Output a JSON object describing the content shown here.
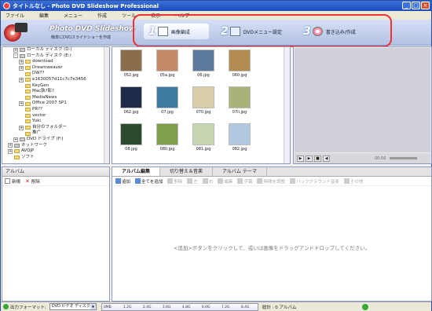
{
  "window": {
    "title": "タイトルなし - Photo DVD Slideshow Professional"
  },
  "menu": [
    "ファイル",
    "編集",
    "メニュー",
    "作成",
    "ツール",
    "表示",
    "ヘルプ"
  ],
  "banner": {
    "app_name": "Photo DVD Slideshow",
    "tagline": "簡単にDVDスライドショーを作成"
  },
  "steps": [
    {
      "num": "1",
      "label": "画像編成"
    },
    {
      "num": "2",
      "label": "DVDメニュー設定"
    },
    {
      "num": "3",
      "label": "書き込み/作成"
    }
  ],
  "tree": [
    {
      "label": "ローカル ディスク (D:)",
      "indent": 2,
      "exp": "+",
      "drive": true
    },
    {
      "label": "ローカル ディスク (E:)",
      "indent": 2,
      "exp": "-",
      "drive": true
    },
    {
      "label": "download",
      "indent": 3,
      "exp": "+"
    },
    {
      "label": "Dreamweaver",
      "indent": 3,
      "exp": "+"
    },
    {
      "label": "DW??",
      "indent": 3,
      "exp": ""
    },
    {
      "label": "e1630057d11c7c7e3456",
      "indent": 3,
      "exp": "+"
    },
    {
      "label": "KeyGen",
      "indent": 3,
      "exp": ""
    },
    {
      "label": "Mac執?影?",
      "indent": 3,
      "exp": ""
    },
    {
      "label": "MediaNews",
      "indent": 3,
      "exp": ""
    },
    {
      "label": "Office 2007 SP1",
      "indent": 3,
      "exp": "+"
    },
    {
      "label": "PR??",
      "indent": 3,
      "exp": ""
    },
    {
      "label": "vector",
      "indent": 3,
      "exp": ""
    },
    {
      "label": "Yuki",
      "indent": 3,
      "exp": ""
    },
    {
      "label": "自分のフォルダー",
      "indent": 3,
      "exp": "+"
    },
    {
      "label": "推广",
      "indent": 3,
      "exp": ""
    },
    {
      "label": "DVD ドライブ (F:)",
      "indent": 2,
      "exp": "+",
      "drive": true
    },
    {
      "label": "ネットワーク",
      "indent": 1,
      "exp": "+",
      "drive": true
    },
    {
      "label": "AVOJP",
      "indent": 1,
      "exp": "+"
    },
    {
      "label": "ソフト",
      "indent": 1,
      "exp": ""
    }
  ],
  "thumbnails": [
    {
      "caption": "052.jpg",
      "color": "#8a6d4a"
    },
    {
      "caption": "05a.jpg",
      "color": "#c48a6a"
    },
    {
      "caption": "06.jpg",
      "color": "#5d7a9c"
    },
    {
      "caption": "060.jpg",
      "color": "#b28b4f"
    },
    {
      "caption": "062.jpg",
      "color": "#1e2a48"
    },
    {
      "caption": "07.jpg",
      "color": "#3d7aa0"
    },
    {
      "caption": "070.jpg",
      "color": "#d8cfa8"
    },
    {
      "caption": "07ii.jpg",
      "color": "#a8b37a"
    },
    {
      "caption": "08.jpg",
      "color": "#2c4a2e"
    },
    {
      "caption": "080.jpg",
      "color": "#7fa04a"
    },
    {
      "caption": "081.jpg",
      "color": "#c6d6b0"
    },
    {
      "caption": "082.jpg",
      "color": "#b0c8e0"
    }
  ],
  "preview": {
    "time": "00:00"
  },
  "album_panel": {
    "tab": "アルバム",
    "new": "新規",
    "delete": "削除"
  },
  "main_tabs": [
    "アルバム編集",
    "切り替え＆音楽",
    "アルバム テーマ"
  ],
  "main_tools": [
    {
      "label": "追加",
      "enabled": true
    },
    {
      "label": "全てを追加",
      "enabled": true
    },
    {
      "label": "削除",
      "enabled": false
    },
    {
      "label": "左",
      "enabled": false
    },
    {
      "label": "右",
      "enabled": false
    },
    {
      "label": "編集",
      "enabled": false
    },
    {
      "label": "字幕",
      "enabled": false
    },
    {
      "label": "時間を調整",
      "enabled": false
    },
    {
      "label": "バックグラウンド音楽",
      "enabled": false
    },
    {
      "label": "その他",
      "enabled": false
    }
  ],
  "hint": "<追加>ボタンをクリックして、或いは画像をドラッグアンドドロップしてください。",
  "status": {
    "format_label": "出力フォーマット:",
    "format_value": "DVD ビデオ ディスク",
    "scale": [
      "0MB",
      "1.2G",
      "2.4G",
      "3.6G",
      "4.8G",
      "6.0G",
      "7.2G",
      "8.4G"
    ],
    "total": "総計 : 0 アルバム"
  },
  "colors": {
    "accent": "#2a4f9e",
    "highlight": "#e33"
  }
}
